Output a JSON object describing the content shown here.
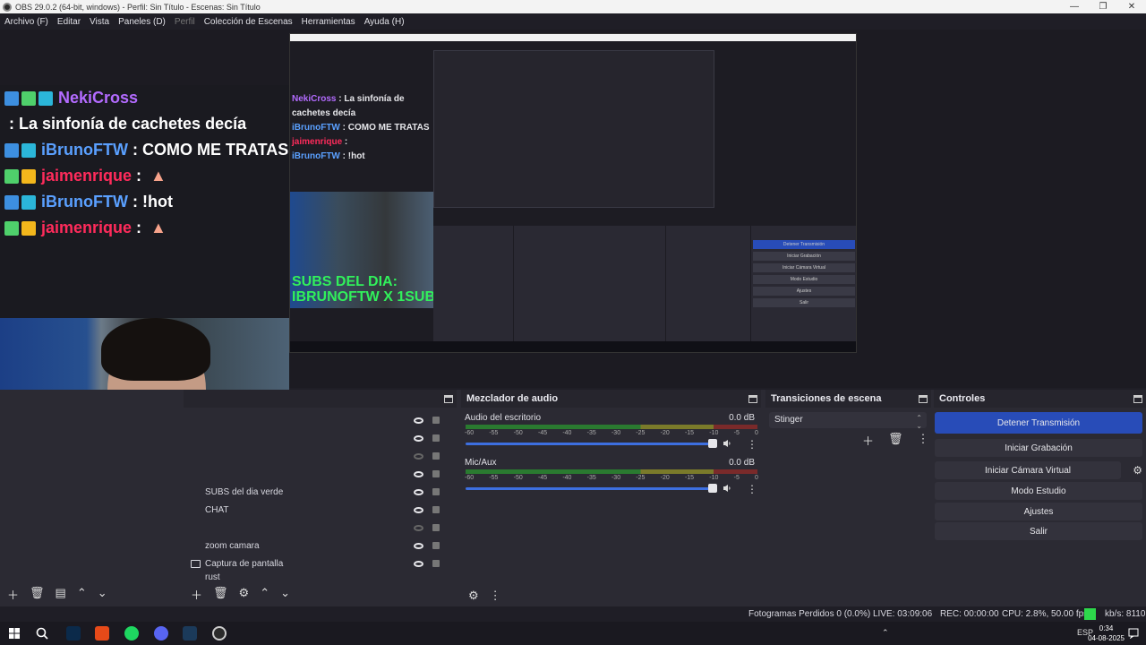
{
  "window": {
    "title": "OBS 29.0.2 (64-bit, windows) - Perfil: Sin Título - Escenas: Sin Título",
    "controls": [
      "—",
      "❐",
      "✕"
    ]
  },
  "menu": [
    "Archivo (F)",
    "Editar",
    "Vista",
    "Paneles (D)",
    "Perfil",
    "Colección de Escenas",
    "Herramientas",
    "Ayuda (H)"
  ],
  "chat": [
    {
      "nick": "NekiCross",
      "nick_color": "purple",
      "text": " : La sinfonía de cachetes decía",
      "badges": [
        "blue",
        "green",
        "cyan"
      ]
    },
    {
      "nick": "iBrunoFTW",
      "nick_color": "blue",
      "text": " : COMO ME TRATAS",
      "badges": [
        "blue",
        "cyan"
      ]
    },
    {
      "nick": "jaimenrique",
      "nick_color": "red",
      "text": " :  ",
      "badges": [
        "green",
        "gold"
      ]
    },
    {
      "nick": "iBrunoFTW",
      "nick_color": "blue",
      "text": " : !hot",
      "badges": [
        "blue",
        "cyan"
      ]
    },
    {
      "nick": "jaimenrique",
      "nick_color": "red",
      "text": " :  ",
      "badges": [
        "green",
        "gold"
      ]
    }
  ],
  "overlay": {
    "subs_line1": "SUBS DEL DIA:",
    "subs_line2": "IBRUNOFTW X 1SUB"
  },
  "sources": {
    "items": [
      {
        "label": "SUBS del dia verde",
        "visible": true
      },
      {
        "label": "CHAT",
        "visible": true
      },
      {
        "label": "",
        "visible": false
      },
      {
        "label": "zoom camara",
        "visible": true
      },
      {
        "label": "Captura de pantalla",
        "visible": true
      },
      {
        "label": "rust",
        "visible": true
      }
    ],
    "extra_rows_visible": [
      true,
      true,
      false,
      true,
      true,
      true,
      false,
      true,
      true,
      true
    ]
  },
  "mixer": {
    "title": "Mezclador de audio",
    "tracks": [
      {
        "name": "Audio del escritorio",
        "db": "0.0 dB"
      },
      {
        "name": "Mic/Aux",
        "db": "0.0 dB"
      }
    ],
    "scale": [
      "-60",
      "-55",
      "-50",
      "-45",
      "-40",
      "-35",
      "-30",
      "-25",
      "-20",
      "-15",
      "-10",
      "-5",
      "0"
    ]
  },
  "transitions": {
    "title": "Transiciones de escena",
    "selected": "Stinger"
  },
  "controls": {
    "title": "Controles",
    "buttons": [
      "Detener Transmisión",
      "Iniciar Grabación",
      "Iniciar Cámara Virtual",
      "Modo Estudio",
      "Ajustes",
      "Salir"
    ]
  },
  "status": {
    "dropped": "Fotogramas Perdidos 0 (0.0%)",
    "live": "LIVE: 03:09:06",
    "rec": "REC: 00:00:00",
    "cpu": "CPU: 2.8%, 50.00 fps",
    "kbps": "kb/s: 8110"
  },
  "taskbar": {
    "lang": "ESP",
    "time": "0:34",
    "date": "04-08-2025"
  },
  "colors": {
    "accent": "#284cb8",
    "subs_green": "#31f05b",
    "status_green": "#2dd84b"
  }
}
